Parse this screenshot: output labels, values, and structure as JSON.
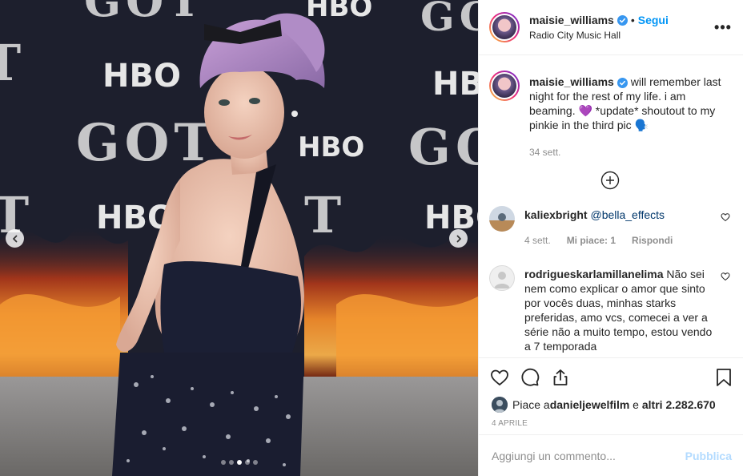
{
  "post": {
    "username": "maisie_williams",
    "separator": "•",
    "follow_label": "Segui",
    "location": "Radio City Music Hall",
    "more_label": "•••"
  },
  "caption": {
    "username": "maisie_williams",
    "text": " will remember last night for the rest of my life. i am beaming. 💜 *update* shoutout to my pinkie in the third pic 🗣️",
    "time": "34 sett."
  },
  "comments": [
    {
      "username": "kaliexbright",
      "text": " @bella_effects",
      "time": "4 sett.",
      "likes": "Mi piace: 1",
      "reply": "Rispondi"
    },
    {
      "username": "rodrigueskarlamillanelima",
      "text": " Não sei nem como explicar o amor que sinto por vocês duas, minhas starks preferidas, amo vcs, comecei a ver a série não a muito tempo, estou vendo a 7 temporada"
    }
  ],
  "likes": {
    "prefix": "Piace a ",
    "user": "danieljewelfilm",
    "middle": " e ",
    "others": "altri 2.282.670"
  },
  "date": "4 APRILE",
  "add_comment": {
    "placeholder": "Aggiungi un commento...",
    "publish_label": "Pubblica"
  },
  "carousel": {
    "slide_count": 5,
    "active_slide": 2
  },
  "colors": {
    "accent": "#0095f6",
    "verified": "#3897f0",
    "muted": "#8e8e8e",
    "publish_disabled": "#b3dbff"
  },
  "photo": {
    "backdrop_logos": [
      "GOT",
      "HBO",
      "GOT",
      "HBO",
      "GOT",
      "HBO",
      "GOT",
      "HBO",
      "GOT",
      "HBO",
      "GOT"
    ]
  }
}
